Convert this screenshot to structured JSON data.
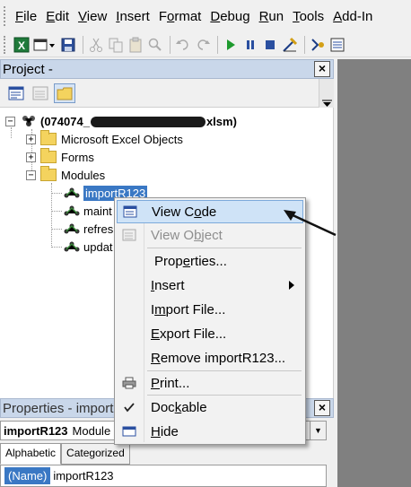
{
  "menubar": {
    "items": [
      {
        "pre": "",
        "acc": "F",
        "post": "ile"
      },
      {
        "pre": "",
        "acc": "E",
        "post": "dit"
      },
      {
        "pre": "",
        "acc": "V",
        "post": "iew"
      },
      {
        "pre": "",
        "acc": "I",
        "post": "nsert"
      },
      {
        "pre": "F",
        "acc": "o",
        "post": "rmat"
      },
      {
        "pre": "",
        "acc": "D",
        "post": "ebug"
      },
      {
        "pre": "",
        "acc": "R",
        "post": "un"
      },
      {
        "pre": "",
        "acc": "T",
        "post": "ools"
      },
      {
        "pre": "",
        "acc": "A",
        "post": "dd-In"
      }
    ]
  },
  "project": {
    "title": "Project -",
    "close": "×",
    "root_label_prefix": "(074074_",
    "root_label_suffix": "xlsm)",
    "nodes": {
      "excel_objects": "Microsoft Excel Objects",
      "forms": "Forms",
      "modules": "Modules",
      "module1": "importR123",
      "module2": "maint",
      "module3": "refres",
      "module4": "updat"
    }
  },
  "properties": {
    "title": "Properties - import",
    "close": "×",
    "combo_name": "importR123",
    "combo_type": "Module",
    "tab_alphabetic": "Alphabetic",
    "tab_categorized": "Categorized",
    "prop_name": "(Name)",
    "prop_value": "importR123"
  },
  "context_menu": {
    "items": [
      {
        "pre": "View C",
        "acc": "o",
        "post": "de"
      },
      {
        "pre": "View O",
        "acc": "b",
        "post": "ject"
      },
      {
        "pre": "Prop",
        "acc": "e",
        "post": "rties..."
      },
      {
        "pre": "",
        "acc": "I",
        "post": "nsert"
      },
      {
        "pre": "I",
        "acc": "m",
        "post": "port File..."
      },
      {
        "pre": "",
        "acc": "E",
        "post": "xport File..."
      },
      {
        "pre": "",
        "acc": "R",
        "post": "emove importR123..."
      },
      {
        "pre": "",
        "acc": "P",
        "post": "rint..."
      },
      {
        "pre": "Doc",
        "acc": "k",
        "post": "able"
      },
      {
        "pre": "",
        "acc": "H",
        "post": "ide"
      }
    ]
  },
  "colors": {
    "selection": "#3a78c4",
    "menu_highlight": "#cfe3f7",
    "pane_title": "#c9d7ea",
    "code_area": "#808080"
  }
}
